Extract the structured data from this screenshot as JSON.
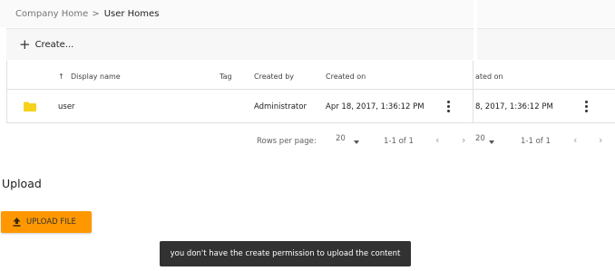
{
  "breadcrumb": {
    "parent": "Company Home",
    "separator": ">",
    "current": "User Homes"
  },
  "toolbar": {
    "create_label": "Create...",
    "create_icon": "plus-icon"
  },
  "table": {
    "columns": {
      "display_name": "Display name",
      "tag": "Tag",
      "created_by": "Created by",
      "created_on": "Created on",
      "sort_icon": "arrow-up-icon"
    },
    "rows": [
      {
        "icon": "folder-icon",
        "name": "user",
        "tag": "",
        "created_by": "Administrator",
        "created_on": "Apr 18, 2017, 1:36:12 PM"
      }
    ]
  },
  "ghost": {
    "created_on_header": "ated on",
    "created_on_value": "8, 2017, 1:36:12 PM",
    "rows_value": "20",
    "range": "1-1 of 1"
  },
  "pagination": {
    "rows_per_page_label": "Rows per page:",
    "rows_value": "20",
    "range": "1-1 of 1"
  },
  "upload": {
    "title": "Upload",
    "button_label": "UPLOAD FILE",
    "button_icon": "upload-icon"
  },
  "snackbar": {
    "message": "you don't have the create permission to upload the content"
  },
  "colors": {
    "accent": "#ff9800",
    "folder": "#f7d21c",
    "snackbar": "#323232"
  }
}
